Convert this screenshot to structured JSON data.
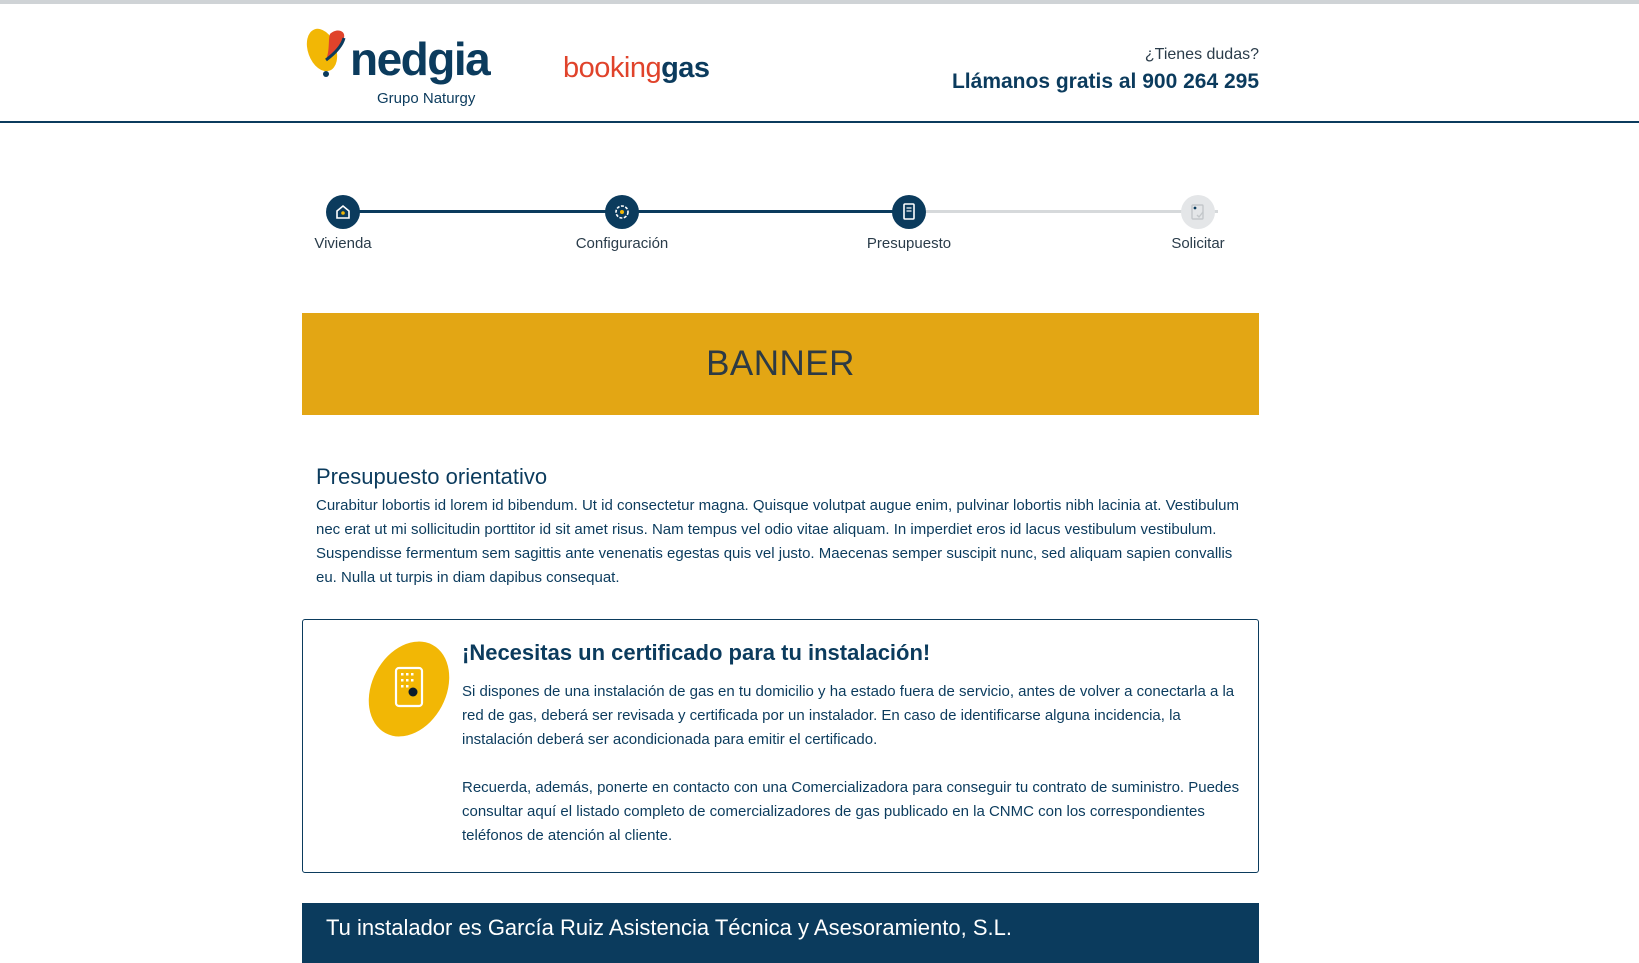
{
  "header": {
    "logo": {
      "brand": "nedgia",
      "subtitle": "Grupo Naturgy"
    },
    "product": {
      "part1": "booking",
      "part2": "gas"
    },
    "help": {
      "question": "¿Tienes dudas?",
      "phone_label": "Llámanos gratis al 900 264 295"
    }
  },
  "stepper": {
    "steps": [
      {
        "label": "Vivienda",
        "state": "completed",
        "icon": "house-icon"
      },
      {
        "label": "Configuración",
        "state": "completed",
        "icon": "gear-icon"
      },
      {
        "label": "Presupuesto",
        "state": "current",
        "icon": "document-icon"
      },
      {
        "label": "Solicitar",
        "state": "pending",
        "icon": "signed-document-icon"
      }
    ]
  },
  "banner": {
    "text": "BANNER"
  },
  "budget": {
    "title": "Presupuesto orientativo",
    "body": "Curabitur lobortis id lorem id bibendum. Ut id consectetur magna. Quisque volutpat augue enim, pulvinar lobortis nibh lacinia at. Vestibulum nec erat ut mi sollicitudin porttitor id sit amet risus. Nam tempus vel odio vitae aliquam. In imperdiet eros id lacus vestibulum vestibulum. Suspendisse fermentum sem sagittis ante venenatis egestas quis vel justo. Maecenas semper suscipit nunc, sed aliquam sapien convallis eu. Nulla ut turpis in diam dapibus consequat."
  },
  "certificate": {
    "title": "¡Necesitas un certificado para tu instalación!",
    "paragraph1": "Si dispones de una instalación de gas en tu domicilio y ha estado fuera de servicio, antes de volver a conectarla a la red de gas, deberá ser revisada y certificada por un instalador. En caso de identificarse alguna incidencia, la instalación deberá ser acondicionada para emitir el certificado.",
    "paragraph2": "Recuerda, además, ponerte en contacto con una Comercializadora para conseguir tu contrato de suministro. Puedes consultar aquí el listado completo de comercializadores de gas publicado en la CNMC con los correspondientes teléfonos de atención al cliente.",
    "icon": "certificate-document-icon"
  },
  "installer": {
    "text": "Tu instalador es García Ruiz Asistencia Técnica y Asesoramiento, S.L."
  },
  "colors": {
    "navy": "#0b3b5d",
    "banner_yellow": "#e3a614",
    "booking_red": "#e0432b",
    "icon_yellow": "#f2b705",
    "inactive_grey": "#d6d9db"
  }
}
